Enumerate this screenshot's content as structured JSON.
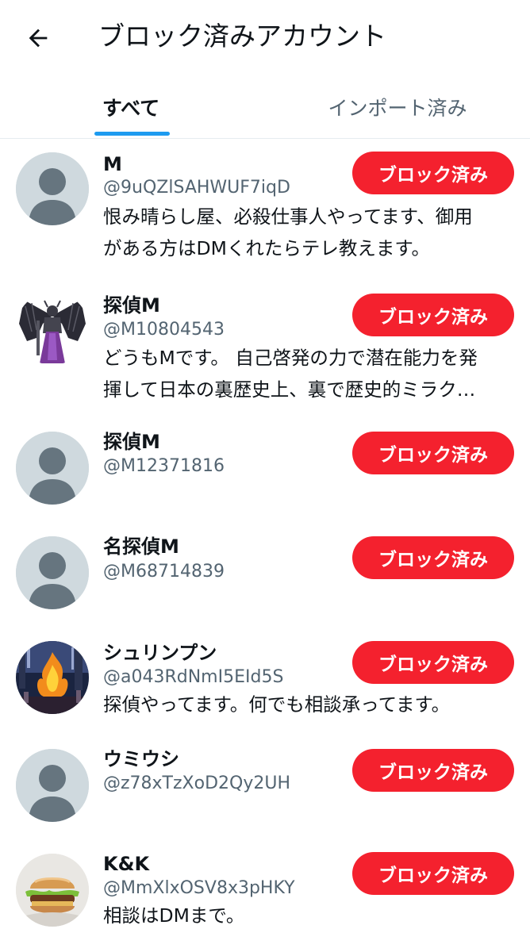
{
  "header": {
    "title": "ブロック済みアカウント",
    "back_icon": "arrow-left-icon"
  },
  "tabs": [
    {
      "label": "すべて",
      "active": true
    },
    {
      "label": "インポート済み",
      "active": false
    }
  ],
  "accent_color": "#1d9bf0",
  "block_button_color": "#f4212e",
  "accounts": [
    {
      "name": "M",
      "handle": "@9uQZlSAHWUF7iqD",
      "bio": [
        "恨み晴らし屋、必殺仕事人やってます、御用",
        "がある方はDMくれたらテレ教えます。"
      ],
      "button": "ブロック済み",
      "avatar": "default-avatar"
    },
    {
      "name": "探偵M",
      "handle": "@M10804543",
      "bio": [
        "どうもMです。 自己啓発の力で潜在能力を発",
        "揮して日本の裏歴史上、裏で歴史的ミラク…"
      ],
      "button": "ブロック済み",
      "avatar": "winged-demon-figure-avatar"
    },
    {
      "name": "探偵M",
      "handle": "@M12371816",
      "bio": [],
      "button": "ブロック済み",
      "avatar": "default-avatar"
    },
    {
      "name": "名探偵M",
      "handle": "@M68714839",
      "bio": [],
      "button": "ブロック済み",
      "avatar": "default-avatar"
    },
    {
      "name": "シュリンプン",
      "handle": "@a043RdNmI5EId5S",
      "bio": [
        "探偵やってます。何でも相談承ってます。"
      ],
      "button": "ブロック済み",
      "avatar": "fire-scene-avatar"
    },
    {
      "name": "ウミウシ",
      "handle": "@z78xTzXoD2Qy2UH",
      "bio": [],
      "button": "ブロック済み",
      "avatar": "default-avatar"
    },
    {
      "name": " K&K",
      "handle": "@MmXlxOSV8x3pHKY",
      "bio": [
        "相談はDMまで。"
      ],
      "button": "ブロック済み",
      "avatar": "burger-photo-avatar"
    }
  ]
}
